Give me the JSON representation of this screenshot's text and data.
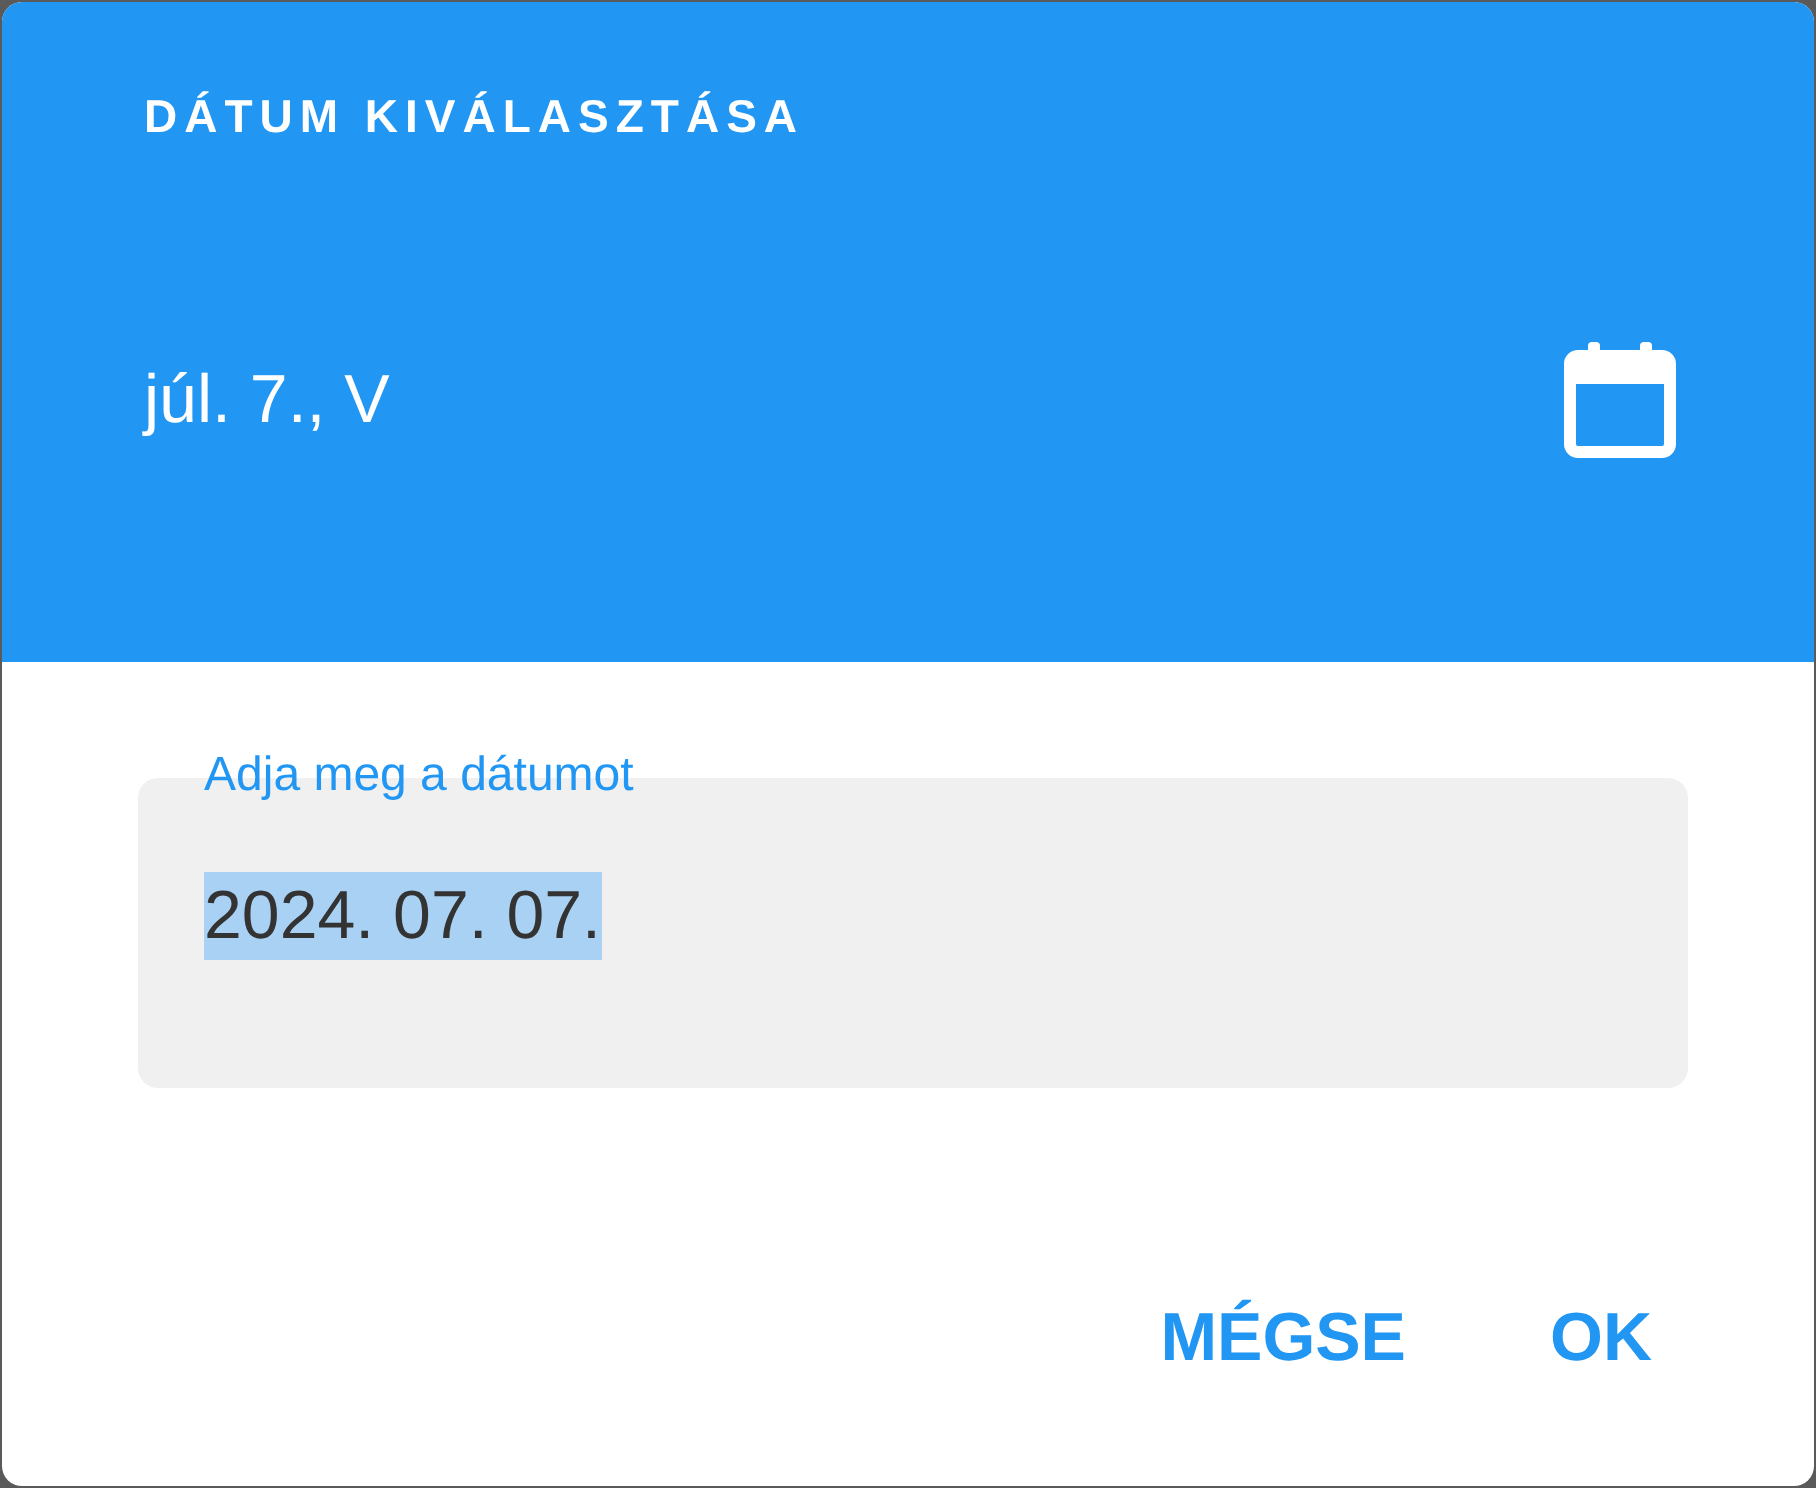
{
  "header": {
    "title": "DÁTUM KIVÁLASZTÁSA",
    "date": "júl. 7., V"
  },
  "field": {
    "label": "Adja meg a dátumot",
    "value": "2024. 07. 07.",
    "value_selected": true
  },
  "buttons": [
    {
      "label": "MÉGSE"
    },
    {
      "label": "OK"
    }
  ]
}
